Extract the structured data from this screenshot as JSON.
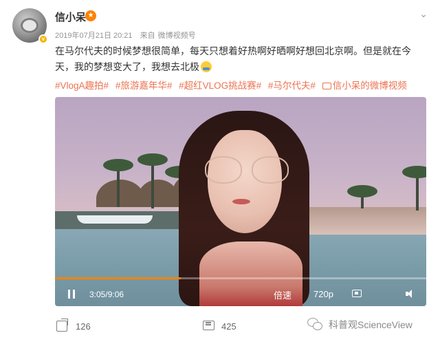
{
  "post": {
    "username": "信小呆",
    "date": "2019年07月21日 20:21",
    "source_prefix": "来自",
    "source": "微博视频号",
    "text": "在马尔代夫的时候梦想很简单，每天只想着好热啊好晒啊好想回北京啊。但是就在今天，我的梦想变大了，我想去北极",
    "tags": [
      "#VlogA趣拍#",
      "#旅游嘉年华#",
      "#超红VLOG挑战赛#",
      "#马尔代夫#"
    ],
    "video_link_label": "信小呆的微博视频"
  },
  "icons": {
    "avatar": "avatar-image",
    "verified": "verified-badge-icon",
    "member": "member-icon",
    "more": "chevron-down-icon",
    "emoji": "face-emoji-icon",
    "video_link": "video-link-icon",
    "pause": "pause-icon",
    "pip": "picture-in-picture-icon",
    "volume": "volume-icon",
    "share": "share-icon",
    "comment": "comment-icon",
    "watermark_logo": "wechat-icon"
  },
  "player": {
    "current_time": "3:05",
    "duration": "9:06",
    "progress_fraction": 0.339,
    "speed_label": "倍速",
    "quality_label": "720p"
  },
  "actions": {
    "share_count": "126",
    "comment_count": "425"
  },
  "watermark": {
    "text": "科普观ScienceView"
  },
  "colors": {
    "accent": "#ff8200",
    "tag": "#eb7350",
    "meta": "#939393"
  }
}
